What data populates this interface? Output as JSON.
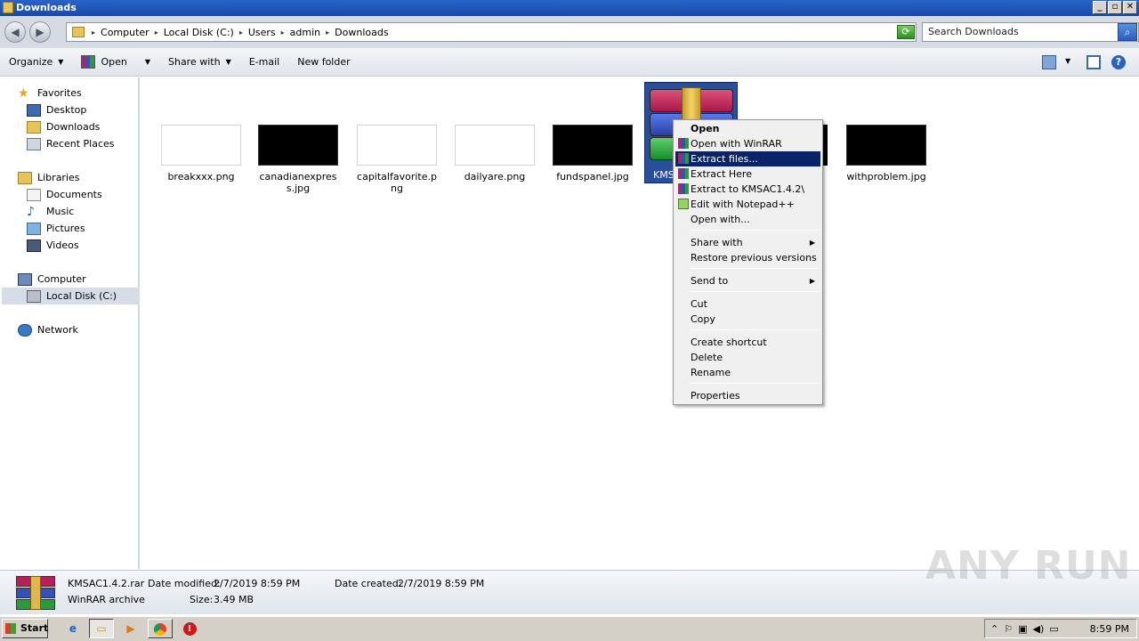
{
  "window": {
    "title": "Downloads",
    "min": "_",
    "max": "▫",
    "close": "✕"
  },
  "address": {
    "crumbs": [
      "Computer",
      "Local Disk (C:)",
      "Users",
      "admin",
      "Downloads"
    ],
    "search_placeholder": "Search Downloads"
  },
  "toolbar": {
    "organize": "Organize",
    "open": "Open",
    "share_with": "Share with",
    "email": "E-mail",
    "new_folder": "New folder"
  },
  "nav": {
    "favorites": "Favorites",
    "desktop": "Desktop",
    "downloads": "Downloads",
    "recent": "Recent Places",
    "libraries": "Libraries",
    "documents": "Documents",
    "music": "Music",
    "pictures": "Pictures",
    "videos": "Videos",
    "computer": "Computer",
    "local_disk": "Local Disk (C:)",
    "network": "Network"
  },
  "files": [
    {
      "name": "breakxxx.png",
      "thumb": "#ffffff"
    },
    {
      "name": "canadianexpress.jpg",
      "thumb": "#000000"
    },
    {
      "name": "capitalfavorite.png",
      "thumb": "#ffffff"
    },
    {
      "name": "dailyare.png",
      "thumb": "#ffffff"
    },
    {
      "name": "fundspanel.jpg",
      "thumb": "#000000"
    },
    {
      "name": "withproblem.jpg",
      "thumb": "#000000"
    }
  ],
  "selected_file": {
    "label": "KMS"
  },
  "context_menu": {
    "open": "Open",
    "open_with_winrar": "Open with WinRAR",
    "extract_files": "Extract files...",
    "extract_here": "Extract Here",
    "extract_to": "Extract to KMSAC1.4.2\\",
    "edit_notepad": "Edit with Notepad++",
    "open_with": "Open with...",
    "share_with": "Share with",
    "restore": "Restore previous versions",
    "send_to": "Send to",
    "cut": "Cut",
    "copy": "Copy",
    "create_shortcut": "Create shortcut",
    "delete": "Delete",
    "rename": "Rename",
    "properties": "Properties"
  },
  "details": {
    "name": "KMSAC1.4.2.rar",
    "type": "WinRAR archive",
    "date_modified_label": "Date modified:",
    "date_modified": "2/7/2019 8:59 PM",
    "size_label": "Size:",
    "size": "3.49 MB",
    "date_created_label": "Date created:",
    "date_created": "2/7/2019 8:59 PM"
  },
  "taskbar": {
    "start": "Start",
    "clock": "8:59 PM"
  },
  "watermark": "ANY RUN",
  "colors": {
    "selection": "#0a246a",
    "title": "#1a4aa8"
  }
}
